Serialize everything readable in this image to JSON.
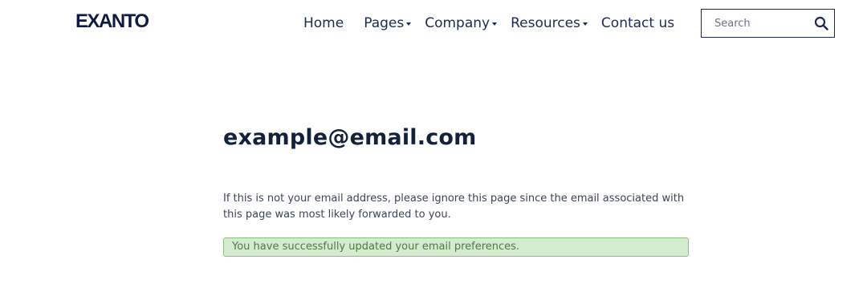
{
  "header": {
    "logo_text": "EXANTO",
    "nav": [
      {
        "label": "Home",
        "has_dropdown": false
      },
      {
        "label": "Pages",
        "has_dropdown": true
      },
      {
        "label": "Company",
        "has_dropdown": true
      },
      {
        "label": "Resources",
        "has_dropdown": true
      },
      {
        "label": "Contact us",
        "has_dropdown": false
      }
    ],
    "search": {
      "placeholder": "Search",
      "value": "",
      "icon": "search-icon"
    }
  },
  "main": {
    "email": "example@email.com",
    "notice": "If this is not your email address, please ignore this page since the email associated with this page was most likely forwarded to you.",
    "success_message": "You have successfully updated your email preferences."
  },
  "colors": {
    "text_navy": "#1b2a4e",
    "success_bg": "#d4ebcf",
    "success_border": "#8cbf7d",
    "success_text": "#4f7a42"
  }
}
